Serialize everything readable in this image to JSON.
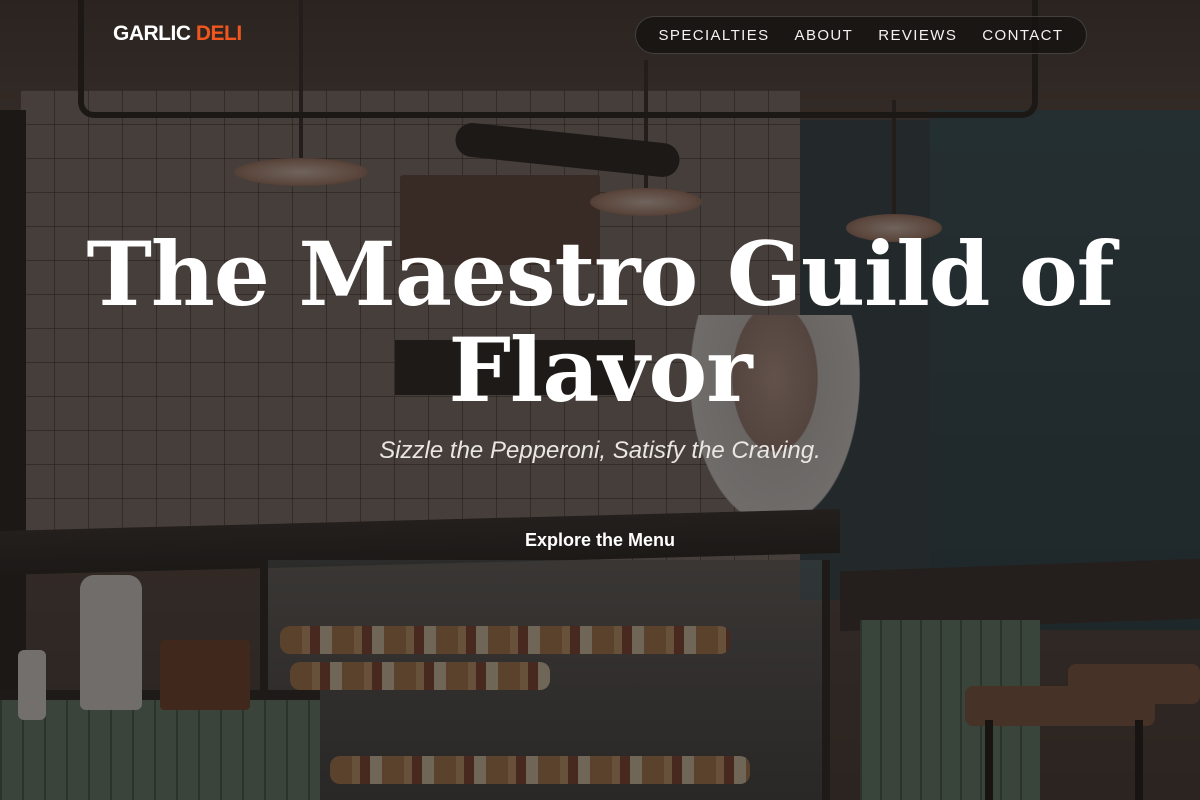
{
  "header": {
    "logo_main": "GARLIC",
    "logo_accent": "DELI",
    "nav": [
      {
        "label": "SPECIALTIES"
      },
      {
        "label": "ABOUT"
      },
      {
        "label": "REVIEWS"
      },
      {
        "label": "CONTACT"
      }
    ]
  },
  "hero": {
    "title": "The Maestro Guild of Flavor",
    "subtitle": "Sizzle the Pepperoni, Satisfy the Craving.",
    "cta_label": "Explore the Menu"
  },
  "colors": {
    "accent": "#f0561d",
    "text": "#ffffff"
  }
}
